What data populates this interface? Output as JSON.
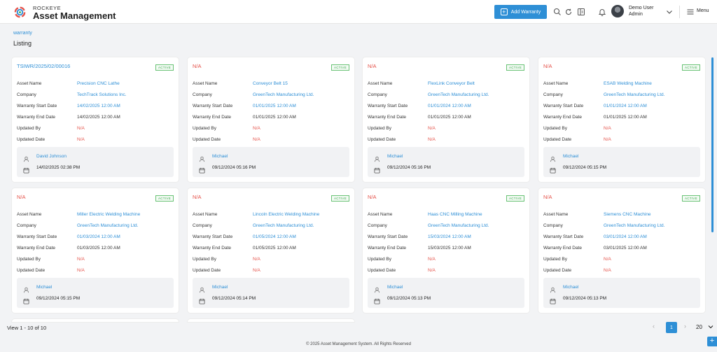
{
  "header": {
    "brand_top": "ROCKEYE",
    "brand_name": "Asset Management",
    "add_button": "Add Warranty",
    "user_name": "Demo User",
    "user_role": "Admin",
    "menu_label": "Menu"
  },
  "breadcrumb": "warranty",
  "page_title": "Listing",
  "labels": {
    "asset": "Asset Name",
    "company": "Company",
    "start": "Warranty Start Date",
    "end": "Warranty End Date",
    "updated_by": "Updated By",
    "updated_date": "Updated Date"
  },
  "cards": [
    {
      "title": "TSIWR/2025/02/00016",
      "status": "ACTIVE",
      "asset": "Precision CNC Lathe",
      "company": "TechTrack Solutions Inc.",
      "start": "14/02/2025 12:00 AM",
      "end": "14/02/2025 12:00 AM",
      "updated_by": "N/A",
      "updated_date": "N/A",
      "user": "David Johnson",
      "date": "14/02/2025 02:38 PM"
    },
    {
      "title": "N/A",
      "status": "ACTIVE",
      "asset": "Conveyor Belt 15",
      "company": "GreenTech Manufacturing Ltd.",
      "start": "01/01/2025 12:00 AM",
      "end": "01/01/2025 12:00 AM",
      "updated_by": "N/A",
      "updated_date": "N/A",
      "user": "Michael",
      "date": "09/12/2024 05:16 PM"
    },
    {
      "title": "N/A",
      "status": "ACTIVE",
      "asset": "FlexLink Conveyor Belt",
      "company": "GreenTech Manufacturing Ltd.",
      "start": "01/01/2024 12:00 AM",
      "end": "01/01/2025 12:00 AM",
      "updated_by": "N/A",
      "updated_date": "N/A",
      "user": "Michael",
      "date": "09/12/2024 05:16 PM"
    },
    {
      "title": "N/A",
      "status": "ACTIVE",
      "asset": "ESAB Welding Machine",
      "company": "GreenTech Manufacturing Ltd.",
      "start": "01/01/2024 12:00 AM",
      "end": "01/01/2025 12:00 AM",
      "updated_by": "N/A",
      "updated_date": "N/A",
      "user": "Michael",
      "date": "09/12/2024 05:15 PM"
    },
    {
      "title": "N/A",
      "status": "ACTIVE",
      "asset": "Miller Electric Welding Machine",
      "company": "GreenTech Manufacturing Ltd.",
      "start": "01/03/2024 12:00 AM",
      "end": "01/03/2025 12:00 AM",
      "updated_by": "N/A",
      "updated_date": "N/A",
      "user": "Michael",
      "date": "09/12/2024 05:15 PM"
    },
    {
      "title": "N/A",
      "status": "ACTIVE",
      "asset": "Lincoln Electric Welding Machine",
      "company": "GreenTech Manufacturing Ltd.",
      "start": "01/05/2024 12:00 AM",
      "end": "01/05/2025 12:00 AM",
      "updated_by": "N/A",
      "updated_date": "N/A",
      "user": "Michael",
      "date": "09/12/2024 05:14 PM"
    },
    {
      "title": "N/A",
      "status": "ACTIVE",
      "asset": "Haas CNC Milling Machine",
      "company": "GreenTech Manufacturing Ltd.",
      "start": "15/03/2024 12:00 AM",
      "end": "15/03/2025 12:00 AM",
      "updated_by": "N/A",
      "updated_date": "N/A",
      "user": "Michael",
      "date": "09/12/2024 05:13 PM"
    },
    {
      "title": "N/A",
      "status": "ACTIVE",
      "asset": "Siemens CNC Machine",
      "company": "GreenTech Manufacturing Ltd.",
      "start": "03/01/2024 12:00 AM",
      "end": "03/01/2025 12:00 AM",
      "updated_by": "N/A",
      "updated_date": "N/A",
      "user": "Michael",
      "date": "09/12/2024 05:13 PM"
    }
  ],
  "pagination": {
    "view_info": "View 1 - 10 of 10",
    "prev": "‹",
    "current": "1",
    "next": "›",
    "page_size": "20"
  },
  "footer": "© 2025 Asset Management System. All Rights Reserved",
  "colors": {
    "accent": "#2e8fd6",
    "na_red": "#e5534b",
    "active_green": "#3aa94b"
  }
}
